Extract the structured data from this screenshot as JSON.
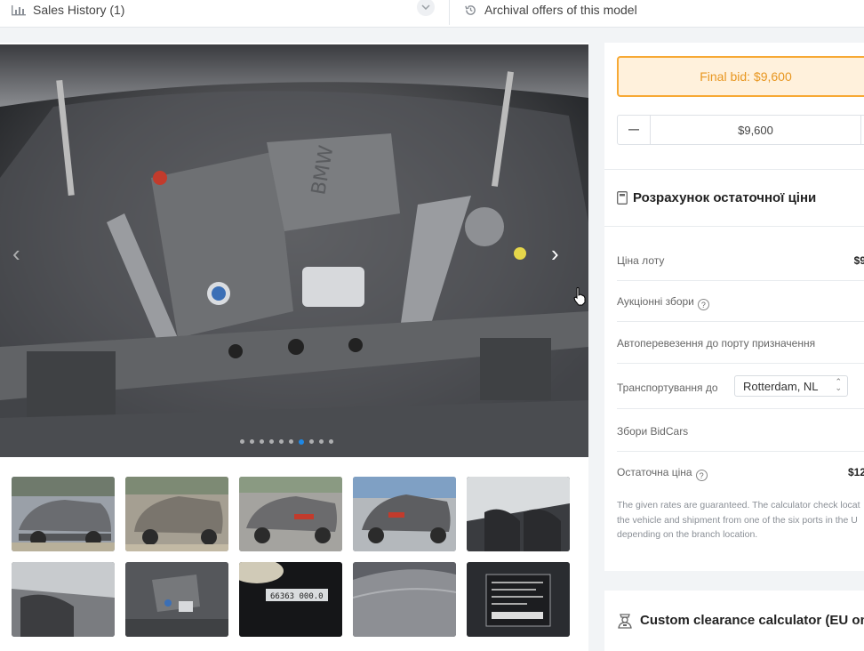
{
  "header": {
    "sales_history_label": "Sales History (1)",
    "archival_label": "Archival offers of this model"
  },
  "gallery": {
    "slide_count": 10,
    "active_slide": 7,
    "main_photo_caption": "BMW engine bay",
    "thumbnails": [
      "front-left exterior",
      "front-right exterior",
      "rear-left exterior",
      "rear exterior",
      "interior front seats",
      "interior rear seats",
      "engine bay",
      "odometer display",
      "roof",
      "VIN label"
    ]
  },
  "bid": {
    "final_bid_label": "Final bid: $9,600",
    "bid_value": "$9,600",
    "colors": {
      "accent": "#f7a935",
      "accent_bg": "#fff1dc",
      "active_dot": "#1e88e5"
    }
  },
  "calculator": {
    "title": "Розрахунок остаточної ціни",
    "rows": {
      "lot_price": {
        "label": "Ціна лоту",
        "value": "$9"
      },
      "auction_fees": {
        "label": "Аукціонні збори"
      },
      "transport_to_port": {
        "label": "Автоперевезення до порту призначення"
      },
      "shipping_to": {
        "label": "Транспортування до",
        "selected": "Rotterdam, NL"
      },
      "bidcars_fees": {
        "label": "Збори BidCars"
      },
      "final_price": {
        "label": "Остаточна ціна",
        "value": "$12"
      }
    },
    "note": "The given rates are guaranteed. The calculator check locat the vehicle and shipment from one of the six ports in the U depending on the branch location."
  },
  "customs": {
    "title": "Custom clearance calculator (EU only)"
  }
}
